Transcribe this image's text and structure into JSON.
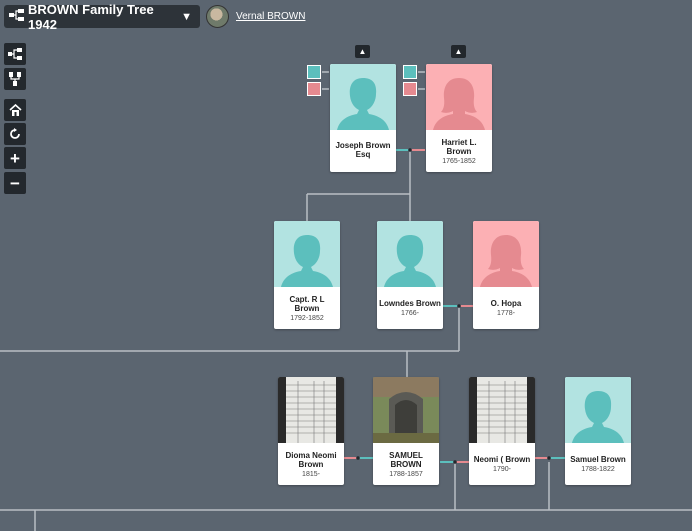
{
  "header": {
    "tree_title": "BROWN Family Tree 1942",
    "user_name": "Vernal BROWN"
  },
  "toolbar": {
    "tools": [
      {
        "icon": "pedigree-view-icon",
        "glyph": "⊰"
      },
      {
        "icon": "descendant-view-icon",
        "glyph": "⑂"
      },
      {
        "icon": "home-icon",
        "glyph": "⌂"
      },
      {
        "icon": "refresh-icon",
        "glyph": "↻"
      },
      {
        "icon": "zoom-in-icon",
        "glyph": "+"
      },
      {
        "icon": "zoom-out-icon",
        "glyph": "−"
      }
    ]
  },
  "colors": {
    "background": "#5b6570",
    "male": "#b2e3e1",
    "female": "#fcb0b4",
    "spouse_line_male": "#5cbfbd",
    "spouse_line_female": "#e58a90"
  },
  "people": {
    "joseph": {
      "name": "Joseph Brown Esq",
      "years": ""
    },
    "harriet": {
      "name": "Harriet L. Brown",
      "years": "1765-1852"
    },
    "captrl": {
      "name": "Capt. R L Brown",
      "years": "1792-1852"
    },
    "lowndes": {
      "name": "Lowndes Brown",
      "years": "1766-"
    },
    "ohopa": {
      "name": "O. Hopa",
      "years": "1778-"
    },
    "dioma": {
      "name": "Dioma Neomi Brown",
      "years": "1815-"
    },
    "samuel1": {
      "name": "SAMUEL BROWN",
      "years": "1788-1857"
    },
    "neomi": {
      "name": "Neomi ( Brown",
      "years": "1790-"
    },
    "samuel2": {
      "name": "Samuel Brown",
      "years": "1788-1822"
    }
  }
}
